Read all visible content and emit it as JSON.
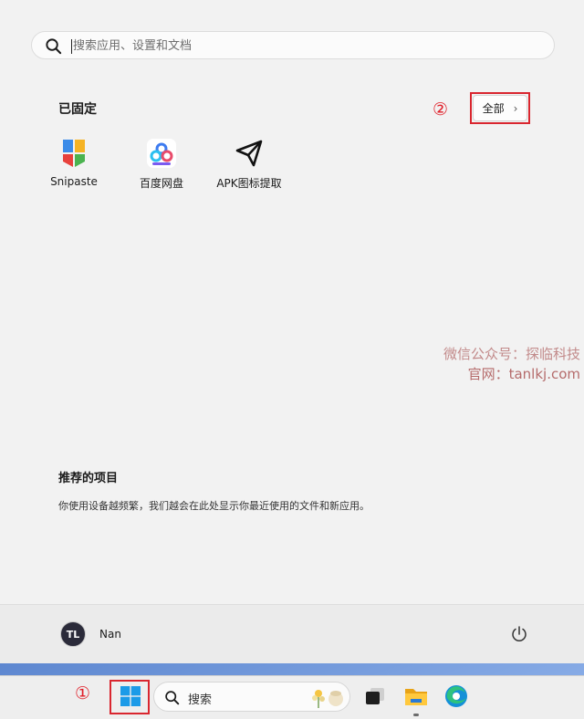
{
  "search": {
    "placeholder": "搜索应用、设置和文档"
  },
  "pinned": {
    "title": "已固定",
    "marker": "②",
    "all_button": {
      "label": "全部",
      "chevron": "›"
    },
    "apps": [
      {
        "label": "Snipaste",
        "icon": "snipaste-icon"
      },
      {
        "label": "百度网盘",
        "icon": "baidu-netdisk-icon"
      },
      {
        "label": "APK图标提取",
        "icon": "apk-icon-extract-icon"
      }
    ]
  },
  "watermark": {
    "line1": "微信公众号：探临科技",
    "line2": "官网：tanlkj.com"
  },
  "recommended": {
    "title": "推荐的项目",
    "text": "你使用设备越频繁，我们越会在此处显示你最近使用的文件和新应用。"
  },
  "user": {
    "name": "Nan",
    "avatar_text": "TL"
  },
  "taskbar": {
    "marker": "①",
    "search_label": "搜索",
    "icons": [
      "windows-start-icon",
      "search-icon",
      "task-view-icon",
      "file-explorer-icon",
      "edge-icon"
    ]
  },
  "colors": {
    "accent": "#0078d4",
    "highlight": "#d9262f"
  }
}
